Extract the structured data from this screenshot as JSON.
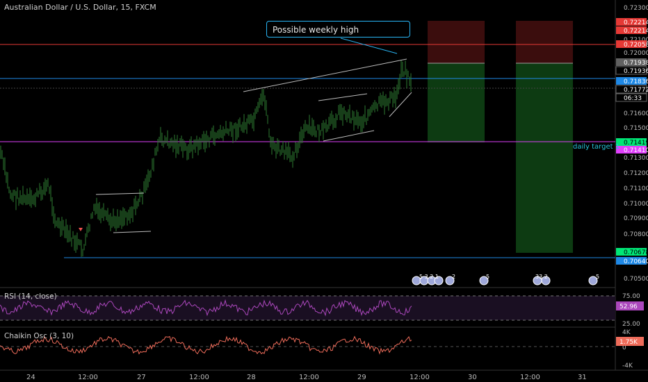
{
  "chart_title": "Australian Dollar / U.S. Dollar, 15, FXCM",
  "callout_text": "Possible weekly high",
  "daily_target_text": "daily target 1",
  "colors": {
    "bg": "#000000",
    "candle": "#2e7d32",
    "red_line": "#e53935",
    "blue_line": "#1e88e5",
    "magenta_line": "#e040fb",
    "rsi": "#ab47bc",
    "chaikin": "#ef6c5a",
    "profit_zone": "#0d3b12",
    "loss_zone": "#3b0d0d"
  },
  "price_axis": {
    "ticks": [
      "0.72300",
      "0.72100",
      "0.72000",
      "0.71600",
      "0.71500",
      "0.71300",
      "0.71200",
      "0.71100",
      "0.71000",
      "0.70900",
      "0.70800",
      "0.70500"
    ],
    "badges": [
      {
        "text": "0.72214",
        "color": "#e53935"
      },
      {
        "text": "0.72214",
        "color": "#e53935"
      },
      {
        "text": "0.72058",
        "color": "#e53935"
      },
      {
        "text": "0.71938",
        "color": "#616161"
      },
      {
        "text": "0.71936",
        "color": "#000000"
      },
      {
        "text": "0.71836",
        "color": "#1e88e5"
      },
      {
        "text": "0.71772",
        "color": "#000000"
      },
      {
        "text": "06:33",
        "color": "#000000"
      },
      {
        "text": "0.71419",
        "color": "#00e676"
      },
      {
        "text": "0.71410",
        "color": "#e040fb"
      },
      {
        "text": "0.70678",
        "color": "#00e676"
      },
      {
        "text": "0.70640",
        "color": "#1e88e5"
      }
    ]
  },
  "time_axis": [
    "24",
    "12:00",
    "27",
    "12:00",
    "28",
    "12:00",
    "29",
    "12:00",
    "30",
    "12:00",
    "31"
  ],
  "events": [
    {
      "label": "5 3 2 1"
    },
    {
      "label": "2"
    },
    {
      "label": "5"
    },
    {
      "label": "33 2"
    },
    {
      "label": "5"
    }
  ],
  "rsi": {
    "title": "RSI (14, close)",
    "value": "52.96",
    "ticks": [
      "75.00",
      "25.00"
    ]
  },
  "chaikin": {
    "title": "Chaikin Osc (3, 10)",
    "value": "1.75K",
    "ticks": [
      "4K",
      "0",
      "-4K"
    ]
  },
  "chart_data": {
    "type": "line",
    "title": "Australian Dollar / U.S. Dollar, 15, FXCM",
    "x": [
      "24",
      "12:00",
      "27",
      "12:00",
      "28",
      "12:00",
      "29",
      "12:00"
    ],
    "series": [
      {
        "values": [
          0.7128,
          0.7086,
          0.7098,
          0.7148,
          0.7163,
          0.7145,
          0.7168,
          0.7184
        ]
      }
    ],
    "ylim": [
      0.705,
      0.723
    ]
  }
}
